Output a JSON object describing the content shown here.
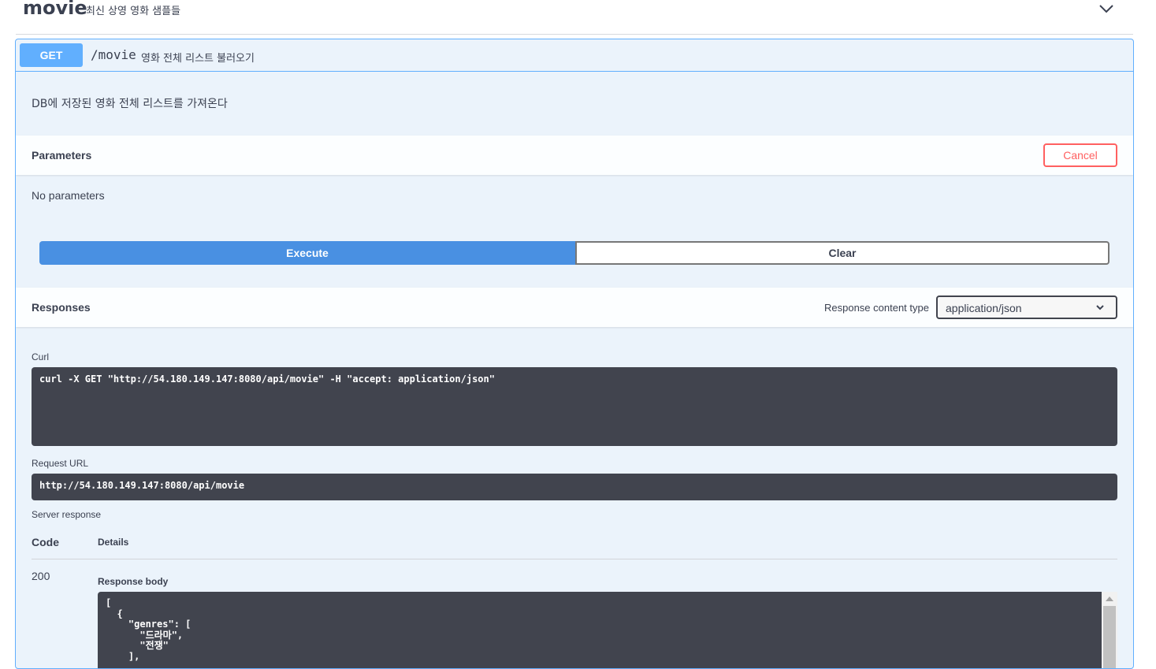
{
  "tag": {
    "name": "movie",
    "description": "최신 상영 영화 샘플들"
  },
  "operation": {
    "method": "GET",
    "path": "/movie",
    "summary": "영화 전체 리스트 불러오기",
    "description": "DB에 저장된 영화 전체 리스트를 가져온다"
  },
  "parameters": {
    "title": "Parameters",
    "cancel_label": "Cancel",
    "empty_text": "No parameters"
  },
  "actions": {
    "execute_label": "Execute",
    "clear_label": "Clear"
  },
  "responses": {
    "title": "Responses",
    "content_type_label": "Response content type",
    "content_type_value": "application/json",
    "curl_label": "Curl",
    "curl_command": "curl -X GET \"http://54.180.149.147:8080/api/movie\" -H \"accept: application/json\"",
    "request_url_label": "Request URL",
    "request_url": "http://54.180.149.147:8080/api/movie",
    "server_response_label": "Server response",
    "table": {
      "code_header": "Code",
      "details_header": "Details"
    },
    "status_code": "200",
    "body_label": "Response body",
    "body_text": "[\n  {\n    \"genres\": [\n      \"드라마\",\n      \"전쟁\"\n    ],"
  },
  "colors": {
    "get_blue": "#61affe",
    "execute_blue": "#4990e2",
    "cancel_red": "#ff6060",
    "code_bg": "#41444e"
  }
}
